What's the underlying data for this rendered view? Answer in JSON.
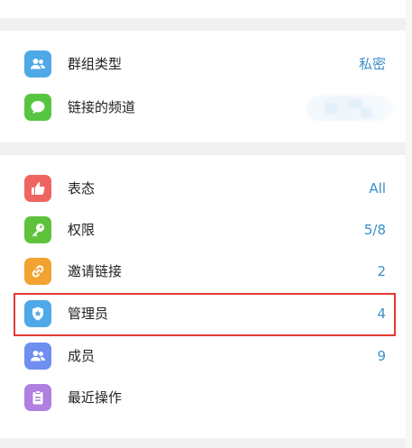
{
  "group_settings": {
    "group_type": {
      "label": "群组类型",
      "value": "私密",
      "icon": "people-icon",
      "color": "#4fa8e8"
    },
    "linked_channel": {
      "label": "链接的频道",
      "value": "",
      "icon": "chat-bubble-icon",
      "color": "#58c542"
    }
  },
  "management": {
    "items": [
      {
        "label": "表态",
        "value": "All",
        "icon": "thumbs-up-icon",
        "color": "#ef6461"
      },
      {
        "label": "权限",
        "value": "5/8",
        "icon": "key-icon",
        "color": "#5ec23c"
      },
      {
        "label": "邀请链接",
        "value": "2",
        "icon": "link-icon",
        "color": "#f2a230"
      },
      {
        "label": "管理员",
        "value": "4",
        "icon": "shield-star-icon",
        "color": "#4fa8e8"
      },
      {
        "label": "成员",
        "value": "9",
        "icon": "people-icon",
        "color": "#6e8ef0"
      },
      {
        "label": "最近操作",
        "value": "",
        "icon": "clipboard-icon",
        "color": "#b07fe0"
      }
    ]
  },
  "highlight": {
    "color": "#e53935",
    "target": "管理员"
  }
}
